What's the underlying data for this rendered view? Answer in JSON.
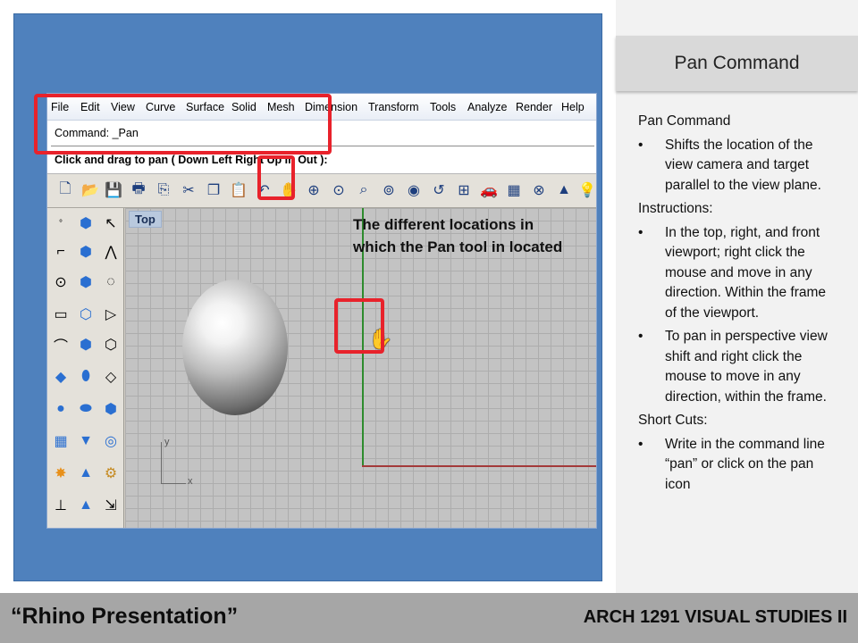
{
  "slide": {
    "title": "Pan Command",
    "footer_left": "“Rhino Presentation”",
    "footer_right": "ARCH 1291 VISUAL STUDIES II"
  },
  "screenshot": {
    "menu": [
      "File",
      "Edit",
      "View",
      "Curve",
      "Surface",
      "Solid",
      "Mesh",
      "Dimension",
      "Transform",
      "Tools",
      "Analyze",
      "Render",
      "Help"
    ],
    "command_line": "Command: _Pan",
    "prompt_line": "Click and drag to pan ( Down  Left  Right  Up  In  Out ):",
    "viewport_label": "Top",
    "annotation": "The different locations in which the Pan tool in located",
    "axis_y": "y",
    "axis_x": "x",
    "toolbar_icons": [
      "new-file-icon",
      "open-folder-icon",
      "save-icon",
      "print-icon",
      "import-icon",
      "cut-icon",
      "copy-icon",
      "paste-icon",
      "undo-icon",
      "pan-hand-icon",
      "rotate-view-icon",
      "zoom-dynamic-icon",
      "zoom-window-icon",
      "zoom-extents-icon",
      "zoom-selected-icon",
      "undo-view-icon",
      "four-viewports-icon",
      "car-render-icon",
      "grid-icon",
      "osnap-icon",
      "cone-icon",
      "light-icon"
    ],
    "pan_cursor_icon": "hand-cursor-icon"
  },
  "notes": {
    "heading": "Pan Command",
    "bullet1": "Shifts the location of the view camera and target parallel to the view plane.",
    "instructions_label": "Instructions:",
    "bullet2": "In the top, right, and front viewport; right click the mouse and move in any direction. Within the frame of the viewport.",
    "bullet3": "To pan in perspective view shift and right click the mouse to move in any direction, within the frame.",
    "shortcuts_label": "Short Cuts:",
    "bullet4": "Write in the command line “pan” or click on the pan icon",
    "bullet_symbol": "•"
  },
  "colors": {
    "panel_blue": "#4f81bd",
    "highlight_red": "#e8222b",
    "footer_gray": "#a6a6a6",
    "title_box_gray": "#d9d9d9"
  }
}
